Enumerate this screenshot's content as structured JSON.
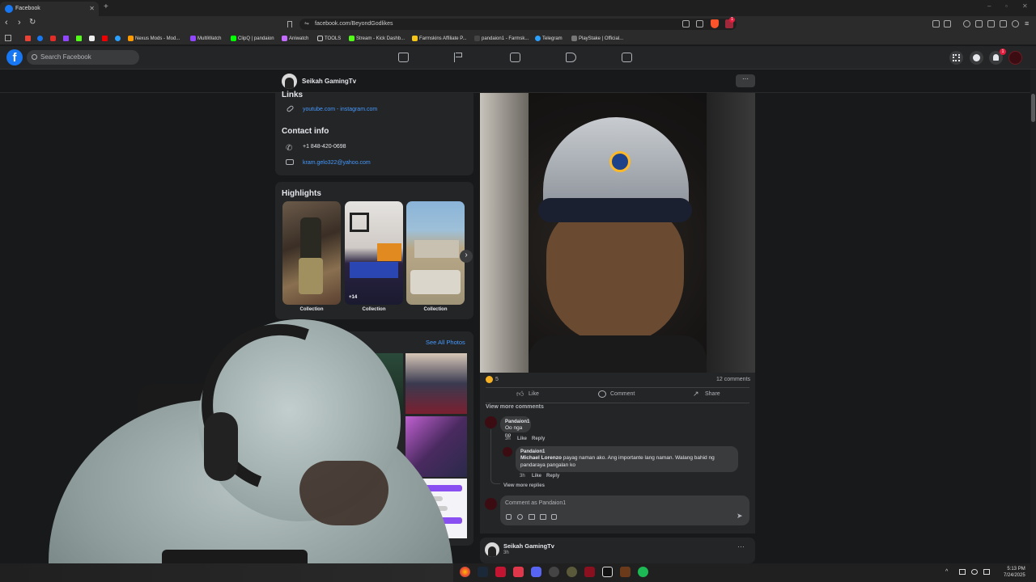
{
  "browser": {
    "tab_title": "Facebook",
    "url": "facebook.com/BeyondGodlikes",
    "bookmarks": [
      "Nexus Mods - Mod...",
      "MultiWatch",
      "ClipQ | pandaion",
      "Aniwatch",
      "TOOLS",
      "Stream - Kick Dashb...",
      "Farmskins Affiliate P...",
      "pandaion1 - Farmsk...",
      "Telegram",
      "PlayStake | Official..."
    ],
    "notification_count": "1"
  },
  "facebook": {
    "search_placeholder": "Search Facebook",
    "notification_badge": "1"
  },
  "profile": {
    "name": "Seikah GamingTv",
    "links_heading": "Links",
    "links_text": "youtube.com - instagram.com",
    "contact_heading": "Contact info",
    "phone": "+1 848-420-0698",
    "email": "kram.gelo322@yahoo.com",
    "highlights_heading": "Highlights",
    "highlights": [
      {
        "label": "Collection",
        "overlay": ""
      },
      {
        "label": "Collection",
        "overlay": "+14"
      },
      {
        "label": "Collection",
        "overlay": ""
      }
    ],
    "see_all_photos": "See All Photos"
  },
  "post": {
    "reaction_count": "5",
    "comment_count": "12 comments",
    "like_label": "Like",
    "comment_label": "Comment",
    "share_label": "Share",
    "view_more_comments": "View more comments",
    "comments": [
      {
        "author": "Pandaion1",
        "text": "Oo nga no",
        "time": "3h",
        "like": "Like",
        "reply": "Reply"
      }
    ],
    "replies": [
      {
        "author": "Pandaion1",
        "mention": "Michael Lorenzo",
        "text": " payag naman ako. Ang importante lang naman. Walang bahid ng pandaraya pangalan ko",
        "time": "3h",
        "like": "Like",
        "reply": "Reply"
      }
    ],
    "view_more_replies": "View more replies",
    "comment_placeholder": "Comment as Pandaion1"
  },
  "next_post": {
    "author": "Seikah GamingTv",
    "time": "3h"
  },
  "taskbar": {
    "time": "5:13 PM",
    "date": "7/24/2025"
  },
  "colors": {
    "fb_blue": "#1877f2",
    "link_blue": "#4599ff",
    "card_bg": "#242526",
    "page_bg": "#18191a"
  }
}
